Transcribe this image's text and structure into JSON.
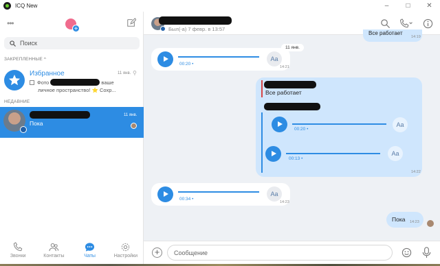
{
  "window": {
    "title": "ICQ New"
  },
  "sidebar": {
    "search_placeholder": "Поиск",
    "pinned_label": "ЗАКРЕПЛЕННЫЕ ^",
    "recent_label": "НЕДАВНИЕ",
    "favorites": {
      "name": "Избранное",
      "time": "11 янв.",
      "preview_line1": "Фото",
      "preview_line1_tail": "ваше",
      "preview_line2": "личное пространство! ⭐ Сохр..."
    },
    "recent_chat": {
      "time": "11 янв.",
      "message": "Пока"
    },
    "nav": [
      {
        "label": "Звонки",
        "icon": "phone-icon"
      },
      {
        "label": "Контакты",
        "icon": "contacts-icon"
      },
      {
        "label": "Чаты",
        "icon": "chat-icon"
      },
      {
        "label": "Настройки",
        "icon": "settings-icon"
      }
    ]
  },
  "chat": {
    "header_status": "Был(-а) 7 февр. в 13:57",
    "date_label": "11 янв.",
    "top_partial_text": "Все работает",
    "top_partial_time": "14:19",
    "messages": {
      "voice1": {
        "duration": "00:20 •",
        "time": "14:21"
      },
      "group": {
        "quote_text": "Все работает",
        "voice_a_duration": "00:20 •",
        "voice_b_duration": "00:13 •",
        "time": "14:22"
      },
      "voice2": {
        "duration": "00:34 •",
        "time": "14:23"
      },
      "text_out": {
        "text": "Пока",
        "time": "14:23"
      }
    },
    "aa_label": "Aa",
    "composer_placeholder": "Сообщение"
  },
  "colors": {
    "accent": "#2d8ce3",
    "outgoing_bubble": "#cfe6fd",
    "chat_bg": "#eef1f5"
  }
}
